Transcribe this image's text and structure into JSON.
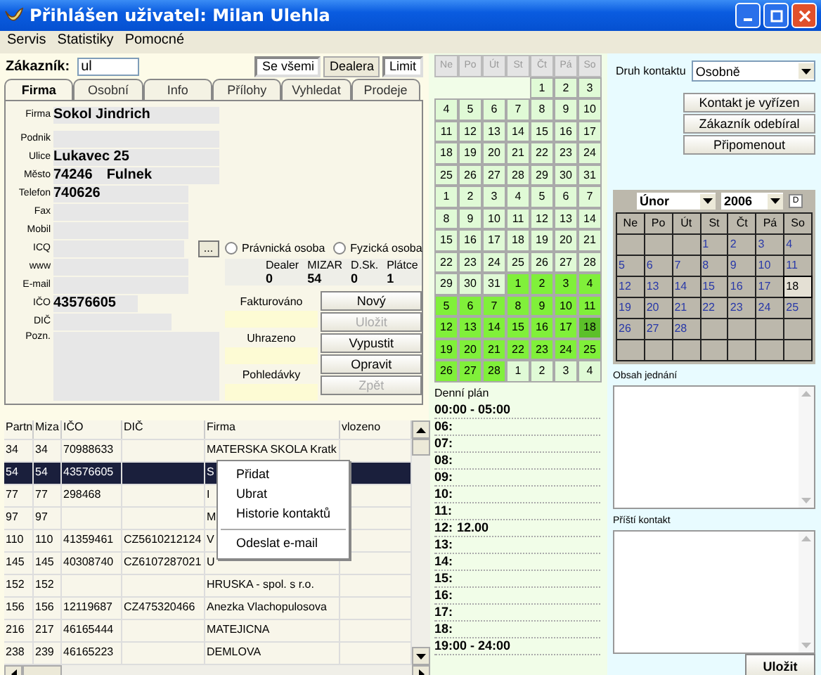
{
  "window": {
    "title": "Přihlášen uživatel: Milan Ulehla"
  },
  "menu": [
    "Servis",
    "Statistiky",
    "Pomocné"
  ],
  "customer": {
    "label": "Zákazník:",
    "value": "ul"
  },
  "filter_buttons": [
    {
      "label": "Se všemi",
      "pressed": true
    },
    {
      "label": "Dealera",
      "pressed": false
    },
    {
      "label": "Limit",
      "pressed": true
    }
  ],
  "tabs": [
    {
      "label": "Firma",
      "selected": true
    },
    {
      "label": "Osobní",
      "selected": false
    },
    {
      "label": "Info",
      "selected": false
    },
    {
      "label": "Přílohy",
      "selected": false
    },
    {
      "label": "Vyhledat",
      "selected": false
    },
    {
      "label": "Prodeje",
      "selected": false
    }
  ],
  "fields": [
    {
      "label": "Firma",
      "kind": "wide",
      "value": "Sokol Jindrich"
    },
    {
      "label": "Podnik",
      "kind": "wide"
    },
    {
      "label": "Ulice",
      "kind": "wide",
      "value": "Lukavec 25"
    },
    {
      "label": "Město",
      "kind": "wide",
      "value": "74246",
      "value_2": "Fulnek"
    },
    {
      "label": "Telefon",
      "kind": "medium",
      "value": "740626"
    },
    {
      "label": "Fax",
      "kind": "medium"
    },
    {
      "label": "Mobil",
      "kind": "medium"
    },
    {
      "label": "ICQ",
      "kind": "medium",
      "button": "..."
    },
    {
      "label": "www",
      "kind": "medium"
    },
    {
      "label": "E-mail",
      "kind": "medium"
    },
    {
      "label": "IČO",
      "kind": "short",
      "value": "43576605"
    },
    {
      "label": "DIČ",
      "kind": "narrow"
    }
  ],
  "note_label": "Pozn.",
  "radios": [
    {
      "label": "Právnická osoba",
      "selected": false
    },
    {
      "label": "Fyzická osoba",
      "selected": false
    }
  ],
  "stats": [
    {
      "label": "Dealer",
      "value": "0"
    },
    {
      "label": "MIZAR",
      "value": "54"
    },
    {
      "label": "D.Sk.",
      "value": "0"
    },
    {
      "label": "Plátce",
      "value": "1"
    }
  ],
  "finance": [
    {
      "label": "Fakturováno"
    },
    {
      "label": "Uhrazeno"
    },
    {
      "label": "Pohledávky"
    }
  ],
  "actions": [
    {
      "label": "Nový",
      "disabled": false
    },
    {
      "label": "Uložit",
      "disabled": true
    },
    {
      "label": "Vypustit",
      "disabled": false
    },
    {
      "label": "Opravit",
      "disabled": false
    },
    {
      "label": "Zpět",
      "disabled": true
    }
  ],
  "table": {
    "columns": [
      "Partn",
      "Miza",
      "IČO",
      "DIČ",
      "Firma",
      "vlozeno"
    ],
    "rows": [
      {
        "selected": false,
        "cells": [
          "34",
          "34",
          "70988633",
          null,
          "MATERSKA SKOLA Kratk",
          null
        ]
      },
      {
        "selected": true,
        "cells": [
          "54",
          "54",
          "43576605",
          null,
          "S",
          null
        ]
      },
      {
        "selected": false,
        "cells": [
          "77",
          "77",
          "298468",
          null,
          "I",
          null
        ]
      },
      {
        "selected": false,
        "cells": [
          "97",
          "97",
          null,
          null,
          "M",
          null
        ]
      },
      {
        "selected": false,
        "cells": [
          "110",
          "110",
          "41359461",
          "CZ5610212124",
          "V",
          null
        ]
      },
      {
        "selected": false,
        "cells": [
          "145",
          "145",
          "40308740",
          "CZ6107287021",
          "U",
          null
        ]
      },
      {
        "selected": false,
        "cells": [
          "152",
          "152",
          null,
          null,
          "HRUSKA - spol. s r.o.",
          null
        ]
      },
      {
        "selected": false,
        "cells": [
          "156",
          "156",
          "12119687",
          "CZ475320466",
          "Anezka Vlachopulosova",
          null
        ]
      },
      {
        "selected": false,
        "cells": [
          "216",
          "217",
          "46165444",
          null,
          "MATEJICNA",
          null
        ]
      },
      {
        "selected": false,
        "cells": [
          "238",
          "239",
          "46165223",
          null,
          "DEMLOVA",
          null
        ]
      }
    ]
  },
  "context_menu": [
    {
      "kind": "item",
      "label": "Přidat"
    },
    {
      "kind": "item",
      "label": "Ubrat"
    },
    {
      "kind": "item",
      "label": "Historie kontaktů"
    },
    {
      "kind": "separator"
    },
    {
      "kind": "item",
      "label": "Odeslat e-mail"
    }
  ],
  "month_grid": {
    "weekdays": [
      "Ne",
      "Po",
      "Út",
      "St",
      "Čt",
      "Pá",
      "So"
    ],
    "weeks": [
      [
        {
          "kind": "blank"
        },
        {
          "kind": "blank"
        },
        {
          "kind": "blank"
        },
        {
          "kind": "blank"
        },
        {
          "day": "1",
          "highlighted": false,
          "selected": false
        },
        {
          "day": "2",
          "highlighted": false,
          "selected": false
        },
        {
          "day": "3",
          "highlighted": false,
          "selected": false
        }
      ],
      [
        {
          "day": "4",
          "highlighted": false,
          "selected": false
        },
        {
          "day": "5",
          "highlighted": false,
          "selected": false
        },
        {
          "day": "6",
          "highlighted": false,
          "selected": false
        },
        {
          "day": "7",
          "highlighted": false,
          "selected": false
        },
        {
          "day": "8",
          "highlighted": false,
          "selected": false
        },
        {
          "day": "9",
          "highlighted": false,
          "selected": false
        },
        {
          "day": "10",
          "highlighted": false,
          "selected": false
        }
      ],
      [
        {
          "day": "11",
          "highlighted": false,
          "selected": false
        },
        {
          "day": "12",
          "highlighted": false,
          "selected": false
        },
        {
          "day": "13",
          "highlighted": false,
          "selected": false
        },
        {
          "day": "14",
          "highlighted": false,
          "selected": false
        },
        {
          "day": "15",
          "highlighted": false,
          "selected": false
        },
        {
          "day": "16",
          "highlighted": false,
          "selected": false
        },
        {
          "day": "17",
          "highlighted": false,
          "selected": false
        }
      ],
      [
        {
          "day": "18",
          "highlighted": false,
          "selected": false
        },
        {
          "day": "19",
          "highlighted": false,
          "selected": false
        },
        {
          "day": "20",
          "highlighted": false,
          "selected": false
        },
        {
          "day": "21",
          "highlighted": false,
          "selected": false
        },
        {
          "day": "22",
          "highlighted": false,
          "selected": false
        },
        {
          "day": "23",
          "highlighted": false,
          "selected": false
        },
        {
          "day": "24",
          "highlighted": false,
          "selected": false
        }
      ],
      [
        {
          "day": "25",
          "highlighted": false,
          "selected": false
        },
        {
          "day": "26",
          "highlighted": false,
          "selected": false
        },
        {
          "day": "27",
          "highlighted": false,
          "selected": false
        },
        {
          "day": "28",
          "highlighted": false,
          "selected": false
        },
        {
          "day": "29",
          "highlighted": false,
          "selected": false
        },
        {
          "day": "30",
          "highlighted": false,
          "selected": false
        },
        {
          "day": "31",
          "highlighted": false,
          "selected": false
        }
      ],
      [
        {
          "day": "1",
          "highlighted": false,
          "selected": false
        },
        {
          "day": "2",
          "highlighted": false,
          "selected": false
        },
        {
          "day": "3",
          "highlighted": false,
          "selected": false
        },
        {
          "day": "4",
          "highlighted": false,
          "selected": false
        },
        {
          "day": "5",
          "highlighted": false,
          "selected": false
        },
        {
          "day": "6",
          "highlighted": false,
          "selected": false
        },
        {
          "day": "7",
          "highlighted": false,
          "selected": false
        }
      ],
      [
        {
          "day": "8",
          "highlighted": false,
          "selected": false
        },
        {
          "day": "9",
          "highlighted": false,
          "selected": false
        },
        {
          "day": "10",
          "highlighted": false,
          "selected": false
        },
        {
          "day": "11",
          "highlighted": false,
          "selected": false
        },
        {
          "day": "12",
          "highlighted": false,
          "selected": false
        },
        {
          "day": "13",
          "highlighted": false,
          "selected": false
        },
        {
          "day": "14",
          "highlighted": false,
          "selected": false
        }
      ],
      [
        {
          "day": "15",
          "highlighted": false,
          "selected": false
        },
        {
          "day": "16",
          "highlighted": false,
          "selected": false
        },
        {
          "day": "17",
          "highlighted": false,
          "selected": false
        },
        {
          "day": "18",
          "highlighted": false,
          "selected": false
        },
        {
          "day": "19",
          "highlighted": false,
          "selected": false
        },
        {
          "day": "20",
          "highlighted": false,
          "selected": false
        },
        {
          "day": "21",
          "highlighted": false,
          "selected": false
        }
      ],
      [
        {
          "day": "22",
          "highlighted": false,
          "selected": false
        },
        {
          "day": "23",
          "highlighted": false,
          "selected": false
        },
        {
          "day": "24",
          "highlighted": false,
          "selected": false
        },
        {
          "day": "25",
          "highlighted": false,
          "selected": false
        },
        {
          "day": "26",
          "highlighted": false,
          "selected": false
        },
        {
          "day": "27",
          "highlighted": false,
          "selected": false
        },
        {
          "day": "28",
          "highlighted": false,
          "selected": false
        }
      ],
      [
        {
          "day": "29",
          "highlighted": false,
          "selected": false
        },
        {
          "day": "30",
          "highlighted": false,
          "selected": false
        },
        {
          "day": "31",
          "highlighted": false,
          "selected": false
        },
        {
          "day": "1",
          "highlighted": true,
          "selected": false
        },
        {
          "day": "2",
          "highlighted": true,
          "selected": false
        },
        {
          "day": "3",
          "highlighted": true,
          "selected": false
        },
        {
          "day": "4",
          "highlighted": true,
          "selected": false
        }
      ],
      [
        {
          "day": "5",
          "highlighted": true,
          "selected": false
        },
        {
          "day": "6",
          "highlighted": true,
          "selected": false
        },
        {
          "day": "7",
          "highlighted": true,
          "selected": false
        },
        {
          "day": "8",
          "highlighted": true,
          "selected": false
        },
        {
          "day": "9",
          "highlighted": true,
          "selected": false
        },
        {
          "day": "10",
          "highlighted": true,
          "selected": false
        },
        {
          "day": "11",
          "highlighted": true,
          "selected": false
        }
      ],
      [
        {
          "day": "12",
          "highlighted": true,
          "selected": false
        },
        {
          "day": "13",
          "highlighted": true,
          "selected": false
        },
        {
          "day": "14",
          "highlighted": true,
          "selected": false
        },
        {
          "day": "15",
          "highlighted": true,
          "selected": false
        },
        {
          "day": "16",
          "highlighted": true,
          "selected": false
        },
        {
          "day": "17",
          "highlighted": true,
          "selected": false
        },
        {
          "day": "18",
          "highlighted": true,
          "selected": true
        }
      ],
      [
        {
          "day": "19",
          "highlighted": true,
          "selected": false
        },
        {
          "day": "20",
          "highlighted": true,
          "selected": false
        },
        {
          "day": "21",
          "highlighted": true,
          "selected": false
        },
        {
          "day": "22",
          "highlighted": true,
          "selected": false
        },
        {
          "day": "23",
          "highlighted": true,
          "selected": false
        },
        {
          "day": "24",
          "highlighted": true,
          "selected": false
        },
        {
          "day": "25",
          "highlighted": true,
          "selected": false
        }
      ],
      [
        {
          "day": "26",
          "highlighted": true,
          "selected": false
        },
        {
          "day": "27",
          "highlighted": true,
          "selected": false
        },
        {
          "day": "28",
          "highlighted": true,
          "selected": false
        },
        {
          "day": "1",
          "highlighted": false,
          "selected": false
        },
        {
          "day": "2",
          "highlighted": false,
          "selected": false
        },
        {
          "day": "3",
          "highlighted": false,
          "selected": false
        },
        {
          "day": "4",
          "highlighted": false,
          "selected": false
        }
      ]
    ]
  },
  "daily_plan": {
    "title": "Denní plán",
    "slots": [
      {
        "time": "00:00 - 05:00"
      },
      {
        "time": "06:"
      },
      {
        "time": "07:"
      },
      {
        "time": "08:"
      },
      {
        "time": "09:"
      },
      {
        "time": "10:"
      },
      {
        "time": "11:"
      },
      {
        "time": "12:",
        "note": "12.00"
      },
      {
        "time": "13:"
      },
      {
        "time": "14:"
      },
      {
        "time": "15:"
      },
      {
        "time": "16:"
      },
      {
        "time": "17:"
      },
      {
        "time": "18:"
      },
      {
        "time": "19:00 - 24:00"
      }
    ]
  },
  "contact": {
    "type_label": "Druh kontaktu",
    "type_value": "Osobně",
    "buttons": [
      "Kontakt je vyřízen",
      "Zákazník odebíral",
      "Připomenout"
    ]
  },
  "calendar": {
    "month": "Únor",
    "year": "2006",
    "today_button": "D",
    "weekdays": [
      "Ne",
      "Po",
      "Út",
      "St",
      "Čt",
      "Pá",
      "So"
    ],
    "weeks": [
      [
        {
          "kind": "blank"
        },
        {
          "kind": "blank"
        },
        {
          "kind": "blank"
        },
        {
          "day": "1",
          "selected": false
        },
        {
          "day": "2",
          "selected": false
        },
        {
          "day": "3",
          "selected": false
        },
        {
          "day": "4",
          "selected": false
        }
      ],
      [
        {
          "day": "5",
          "selected": false
        },
        {
          "day": "6",
          "selected": false
        },
        {
          "day": "7",
          "selected": false
        },
        {
          "day": "8",
          "selected": false
        },
        {
          "day": "9",
          "selected": false
        },
        {
          "day": "10",
          "selected": false
        },
        {
          "day": "11",
          "selected": false
        }
      ],
      [
        {
          "day": "12",
          "selected": false
        },
        {
          "day": "13",
          "selected": false
        },
        {
          "day": "14",
          "selected": false
        },
        {
          "day": "15",
          "selected": false
        },
        {
          "day": "16",
          "selected": false
        },
        {
          "day": "17",
          "selected": false
        },
        {
          "day": "18",
          "selected": true
        }
      ],
      [
        {
          "day": "19",
          "selected": false
        },
        {
          "day": "20",
          "selected": false
        },
        {
          "day": "21",
          "selected": false
        },
        {
          "day": "22",
          "selected": false
        },
        {
          "day": "23",
          "selected": false
        },
        {
          "day": "24",
          "selected": false
        },
        {
          "day": "25",
          "selected": false
        }
      ],
      [
        {
          "day": "26",
          "selected": false
        },
        {
          "day": "27",
          "selected": false
        },
        {
          "day": "28",
          "selected": false
        },
        {
          "kind": "blank"
        },
        {
          "kind": "blank"
        },
        {
          "kind": "blank"
        },
        {
          "kind": "blank"
        }
      ],
      [
        {
          "kind": "blank"
        },
        {
          "kind": "blank"
        },
        {
          "kind": "blank"
        },
        {
          "kind": "blank"
        },
        {
          "kind": "blank"
        },
        {
          "kind": "blank"
        },
        {
          "kind": "blank"
        }
      ]
    ]
  },
  "notes": [
    {
      "label": "Obsah jednání"
    },
    {
      "label": "Příští kontakt"
    }
  ],
  "save_button": "Uložit"
}
